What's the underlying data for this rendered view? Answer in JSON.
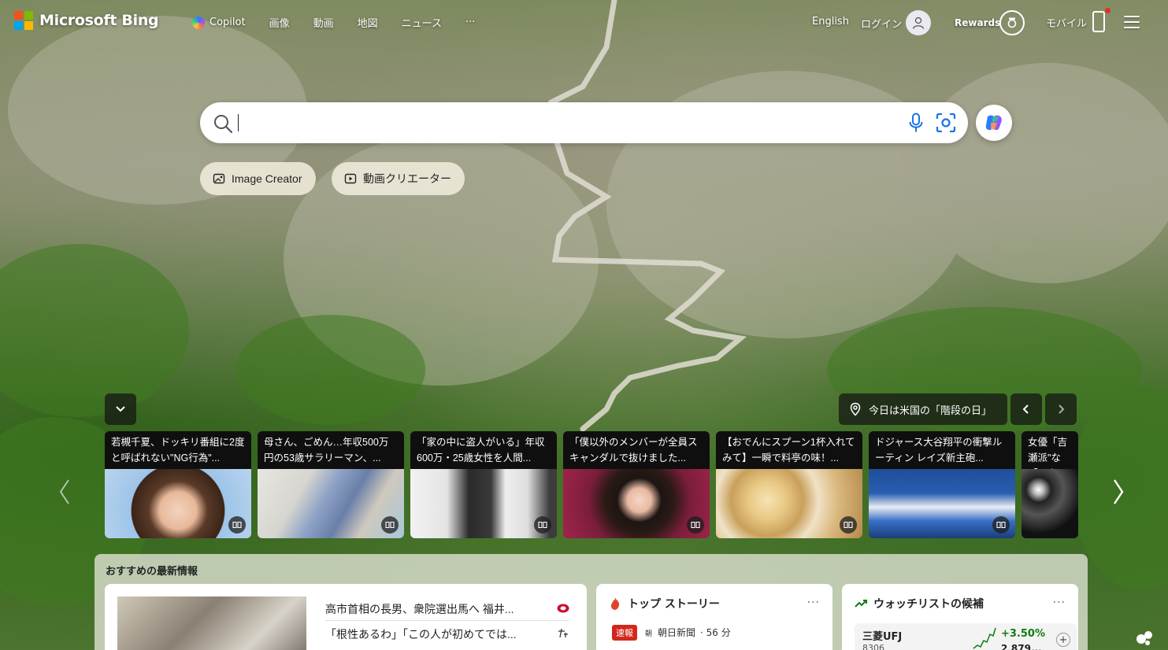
{
  "header": {
    "logo_text": "Microsoft Bing",
    "nav": [
      {
        "label": "Copilot"
      },
      {
        "label": "画像"
      },
      {
        "label": "動画"
      },
      {
        "label": "地図"
      },
      {
        "label": "ニュース"
      },
      {
        "label": "···"
      }
    ],
    "language": "English",
    "login": "ログイン",
    "rewards": "Rewards",
    "mobile": "モバイル"
  },
  "search": {
    "value": "",
    "placeholder": ""
  },
  "chips": {
    "image_creator": "Image Creator",
    "video_creator": "動画クリエーター"
  },
  "info": {
    "today": "今日は米国の「階段の日」"
  },
  "cards": [
    {
      "title": "若槻千夏、ドッキリ番組に2度と呼ばれない\"NG行為\"..."
    },
    {
      "title": "母さん、ごめん…年収500万円の53歳サラリーマン、..."
    },
    {
      "title": "「家の中に盗人がいる」年収600万・25歳女性を人間..."
    },
    {
      "title": "「僕以外のメンバーが全員スキャンダルで抜けました..."
    },
    {
      "title": "【おでんにスプーン1杯入れてみて】一瞬で料亭の味！..."
    },
    {
      "title": "ドジャース大谷翔平の衝撃ルーティン レイズ新主砲..."
    },
    {
      "title": "女優「吉瀬派\"な「国産"
    }
  ],
  "feed": {
    "title": "おすすめの最新情報",
    "headlines": [
      "高市首相の長男、衆院選出馬へ 福井...",
      "「根性あるわ」「この人が初めてでは..."
    ],
    "top_stories": {
      "title": "トップ ストーリー",
      "more": "...",
      "badge": "速報",
      "source": "朝日新聞",
      "time": "· 56 分"
    },
    "watchlist": {
      "title": "ウォッチリストの候補",
      "more": "...",
      "stock_name": "三菱UFJ",
      "stock_code": "8306",
      "change": "+3.50%",
      "price": "2,879..."
    }
  },
  "colors": {
    "accent": "#1a73e8",
    "logo": [
      "#f25022",
      "#7fba00",
      "#00a4ef",
      "#ffb900"
    ],
    "breaking": "#d3271c",
    "stock_up": "#107c10"
  }
}
